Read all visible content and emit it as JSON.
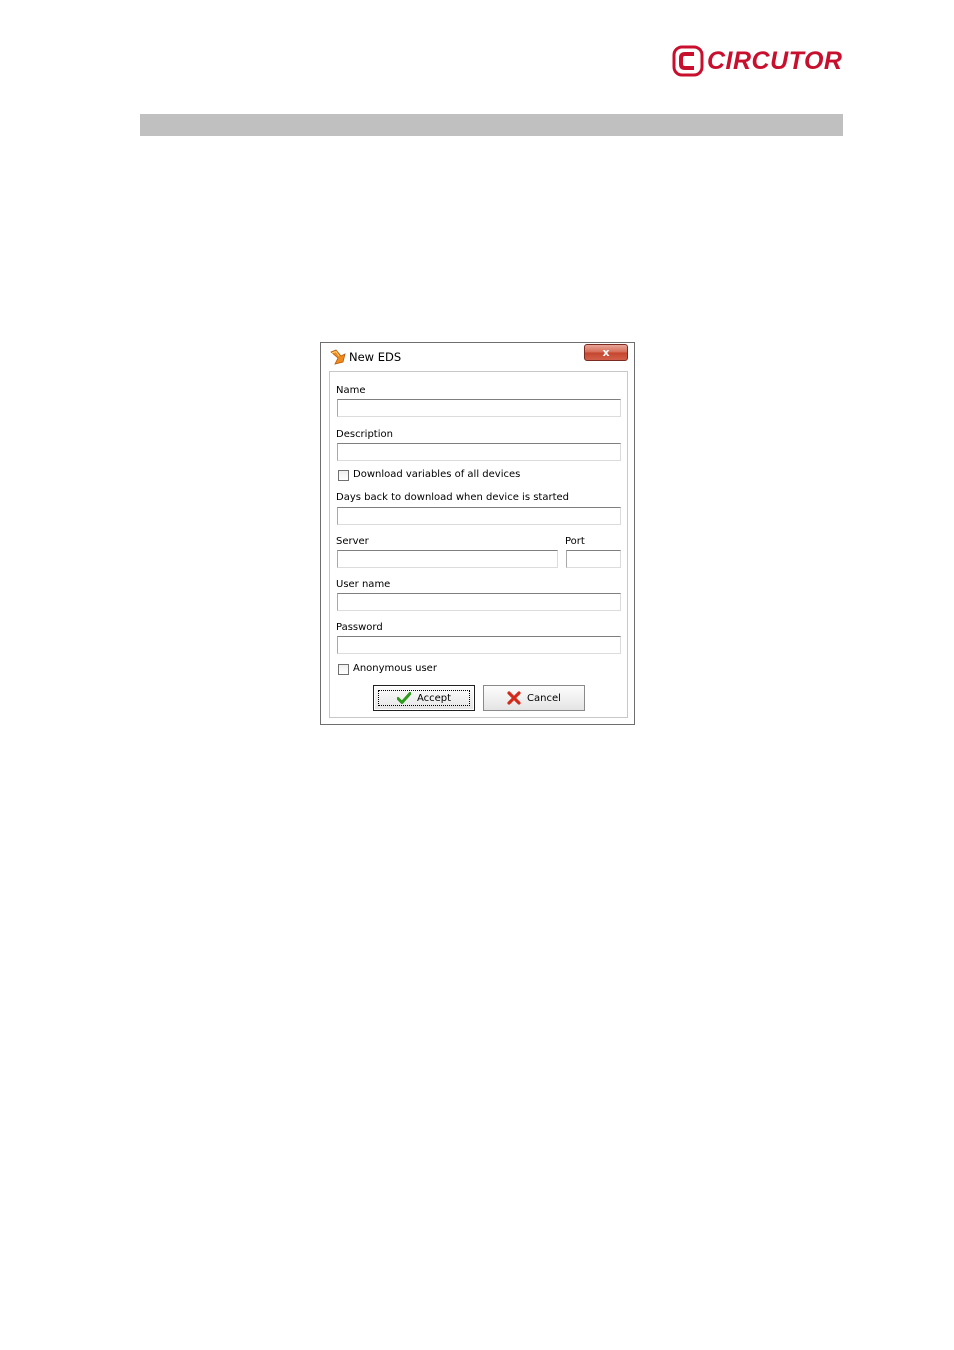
{
  "header": {
    "logo_text": "CIRCUTOR",
    "brand_color": "#c8102e",
    "band_color": "#c0c0c0"
  },
  "dialog": {
    "title": "New EDS",
    "close_label": "x",
    "fields": {
      "name": {
        "label": "Name",
        "value": ""
      },
      "description": {
        "label": "Description",
        "value": ""
      },
      "download_all": {
        "label": "Download variables of all devices",
        "checked": false
      },
      "days_back": {
        "label": "Days back to download when device is started",
        "value": ""
      },
      "server": {
        "label": "Server",
        "value": ""
      },
      "port": {
        "label": "Port",
        "value": ""
      },
      "user_name": {
        "label": "User name",
        "value": ""
      },
      "password": {
        "label": "Password",
        "value": ""
      },
      "anonymous": {
        "label": "Anonymous user",
        "checked": false
      }
    },
    "buttons": {
      "accept": {
        "label": "Accept",
        "icon": "check-icon"
      },
      "cancel": {
        "label": "Cancel",
        "icon": "x-icon"
      }
    }
  }
}
